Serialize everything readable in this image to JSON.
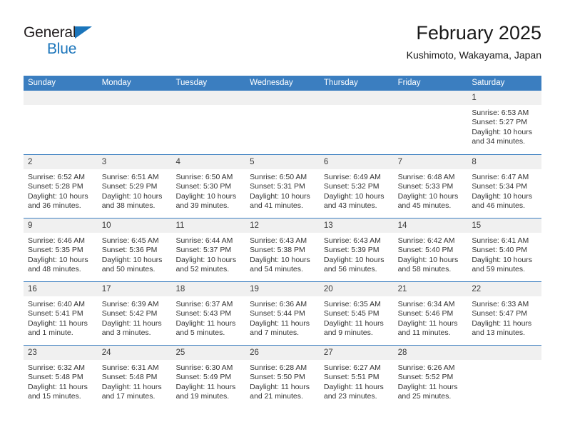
{
  "brand": {
    "name_part1": "General",
    "name_part2": "Blue",
    "accent_color": "#1b75bb"
  },
  "header": {
    "title": "February 2025",
    "subtitle": "Kushimoto, Wakayama, Japan"
  },
  "calendar": {
    "header_bg_color": "#3b7ec0",
    "day_band_color": "#f0f0f0",
    "weekday_headers": [
      "Sunday",
      "Monday",
      "Tuesday",
      "Wednesday",
      "Thursday",
      "Friday",
      "Saturday"
    ],
    "weeks": [
      [
        {
          "day": "",
          "lines": []
        },
        {
          "day": "",
          "lines": []
        },
        {
          "day": "",
          "lines": []
        },
        {
          "day": "",
          "lines": []
        },
        {
          "day": "",
          "lines": []
        },
        {
          "day": "",
          "lines": []
        },
        {
          "day": "1",
          "lines": [
            "Sunrise: 6:53 AM",
            "Sunset: 5:27 PM",
            "Daylight: 10 hours",
            "and 34 minutes."
          ]
        }
      ],
      [
        {
          "day": "2",
          "lines": [
            "Sunrise: 6:52 AM",
            "Sunset: 5:28 PM",
            "Daylight: 10 hours",
            "and 36 minutes."
          ]
        },
        {
          "day": "3",
          "lines": [
            "Sunrise: 6:51 AM",
            "Sunset: 5:29 PM",
            "Daylight: 10 hours",
            "and 38 minutes."
          ]
        },
        {
          "day": "4",
          "lines": [
            "Sunrise: 6:50 AM",
            "Sunset: 5:30 PM",
            "Daylight: 10 hours",
            "and 39 minutes."
          ]
        },
        {
          "day": "5",
          "lines": [
            "Sunrise: 6:50 AM",
            "Sunset: 5:31 PM",
            "Daylight: 10 hours",
            "and 41 minutes."
          ]
        },
        {
          "day": "6",
          "lines": [
            "Sunrise: 6:49 AM",
            "Sunset: 5:32 PM",
            "Daylight: 10 hours",
            "and 43 minutes."
          ]
        },
        {
          "day": "7",
          "lines": [
            "Sunrise: 6:48 AM",
            "Sunset: 5:33 PM",
            "Daylight: 10 hours",
            "and 45 minutes."
          ]
        },
        {
          "day": "8",
          "lines": [
            "Sunrise: 6:47 AM",
            "Sunset: 5:34 PM",
            "Daylight: 10 hours",
            "and 46 minutes."
          ]
        }
      ],
      [
        {
          "day": "9",
          "lines": [
            "Sunrise: 6:46 AM",
            "Sunset: 5:35 PM",
            "Daylight: 10 hours",
            "and 48 minutes."
          ]
        },
        {
          "day": "10",
          "lines": [
            "Sunrise: 6:45 AM",
            "Sunset: 5:36 PM",
            "Daylight: 10 hours",
            "and 50 minutes."
          ]
        },
        {
          "day": "11",
          "lines": [
            "Sunrise: 6:44 AM",
            "Sunset: 5:37 PM",
            "Daylight: 10 hours",
            "and 52 minutes."
          ]
        },
        {
          "day": "12",
          "lines": [
            "Sunrise: 6:43 AM",
            "Sunset: 5:38 PM",
            "Daylight: 10 hours",
            "and 54 minutes."
          ]
        },
        {
          "day": "13",
          "lines": [
            "Sunrise: 6:43 AM",
            "Sunset: 5:39 PM",
            "Daylight: 10 hours",
            "and 56 minutes."
          ]
        },
        {
          "day": "14",
          "lines": [
            "Sunrise: 6:42 AM",
            "Sunset: 5:40 PM",
            "Daylight: 10 hours",
            "and 58 minutes."
          ]
        },
        {
          "day": "15",
          "lines": [
            "Sunrise: 6:41 AM",
            "Sunset: 5:40 PM",
            "Daylight: 10 hours",
            "and 59 minutes."
          ]
        }
      ],
      [
        {
          "day": "16",
          "lines": [
            "Sunrise: 6:40 AM",
            "Sunset: 5:41 PM",
            "Daylight: 11 hours",
            "and 1 minute."
          ]
        },
        {
          "day": "17",
          "lines": [
            "Sunrise: 6:39 AM",
            "Sunset: 5:42 PM",
            "Daylight: 11 hours",
            "and 3 minutes."
          ]
        },
        {
          "day": "18",
          "lines": [
            "Sunrise: 6:37 AM",
            "Sunset: 5:43 PM",
            "Daylight: 11 hours",
            "and 5 minutes."
          ]
        },
        {
          "day": "19",
          "lines": [
            "Sunrise: 6:36 AM",
            "Sunset: 5:44 PM",
            "Daylight: 11 hours",
            "and 7 minutes."
          ]
        },
        {
          "day": "20",
          "lines": [
            "Sunrise: 6:35 AM",
            "Sunset: 5:45 PM",
            "Daylight: 11 hours",
            "and 9 minutes."
          ]
        },
        {
          "day": "21",
          "lines": [
            "Sunrise: 6:34 AM",
            "Sunset: 5:46 PM",
            "Daylight: 11 hours",
            "and 11 minutes."
          ]
        },
        {
          "day": "22",
          "lines": [
            "Sunrise: 6:33 AM",
            "Sunset: 5:47 PM",
            "Daylight: 11 hours",
            "and 13 minutes."
          ]
        }
      ],
      [
        {
          "day": "23",
          "lines": [
            "Sunrise: 6:32 AM",
            "Sunset: 5:48 PM",
            "Daylight: 11 hours",
            "and 15 minutes."
          ]
        },
        {
          "day": "24",
          "lines": [
            "Sunrise: 6:31 AM",
            "Sunset: 5:48 PM",
            "Daylight: 11 hours",
            "and 17 minutes."
          ]
        },
        {
          "day": "25",
          "lines": [
            "Sunrise: 6:30 AM",
            "Sunset: 5:49 PM",
            "Daylight: 11 hours",
            "and 19 minutes."
          ]
        },
        {
          "day": "26",
          "lines": [
            "Sunrise: 6:28 AM",
            "Sunset: 5:50 PM",
            "Daylight: 11 hours",
            "and 21 minutes."
          ]
        },
        {
          "day": "27",
          "lines": [
            "Sunrise: 6:27 AM",
            "Sunset: 5:51 PM",
            "Daylight: 11 hours",
            "and 23 minutes."
          ]
        },
        {
          "day": "28",
          "lines": [
            "Sunrise: 6:26 AM",
            "Sunset: 5:52 PM",
            "Daylight: 11 hours",
            "and 25 minutes."
          ]
        },
        {
          "day": "",
          "lines": []
        }
      ]
    ]
  }
}
